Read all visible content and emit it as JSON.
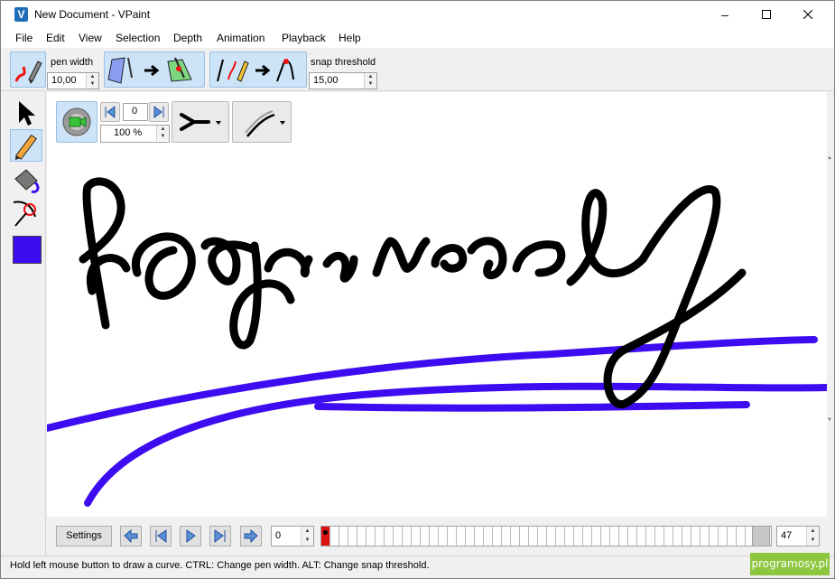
{
  "window": {
    "title": "New Document - VPaint",
    "app_icon_letter": "V"
  },
  "menu": [
    "File",
    "Edit",
    "View",
    "Selection",
    "Depth",
    "Animation",
    "Playback",
    "Help"
  ],
  "toolbar": {
    "pen_width_label": "pen width",
    "pen_width_value": "10,00",
    "snap_threshold_label": "snap threshold",
    "snap_threshold_value": "15,00"
  },
  "view_tools": {
    "frame_value": "0",
    "zoom_value": "100 %"
  },
  "colors": {
    "active_stroke": "#3d0cf0",
    "ink": "#000000",
    "accent": "#cde3f7"
  },
  "toolbox": [
    "select-icon",
    "pencil-icon",
    "paint-bucket-icon",
    "sculpt-icon"
  ],
  "timeline": {
    "settings_label": "Settings",
    "current_frame": "0",
    "last_frame": "47"
  },
  "status": {
    "text": "Hold left mouse button to draw a curve. CTRL: Change pen width. ALT: Change snap threshold."
  },
  "watermark": "programosy.pl"
}
